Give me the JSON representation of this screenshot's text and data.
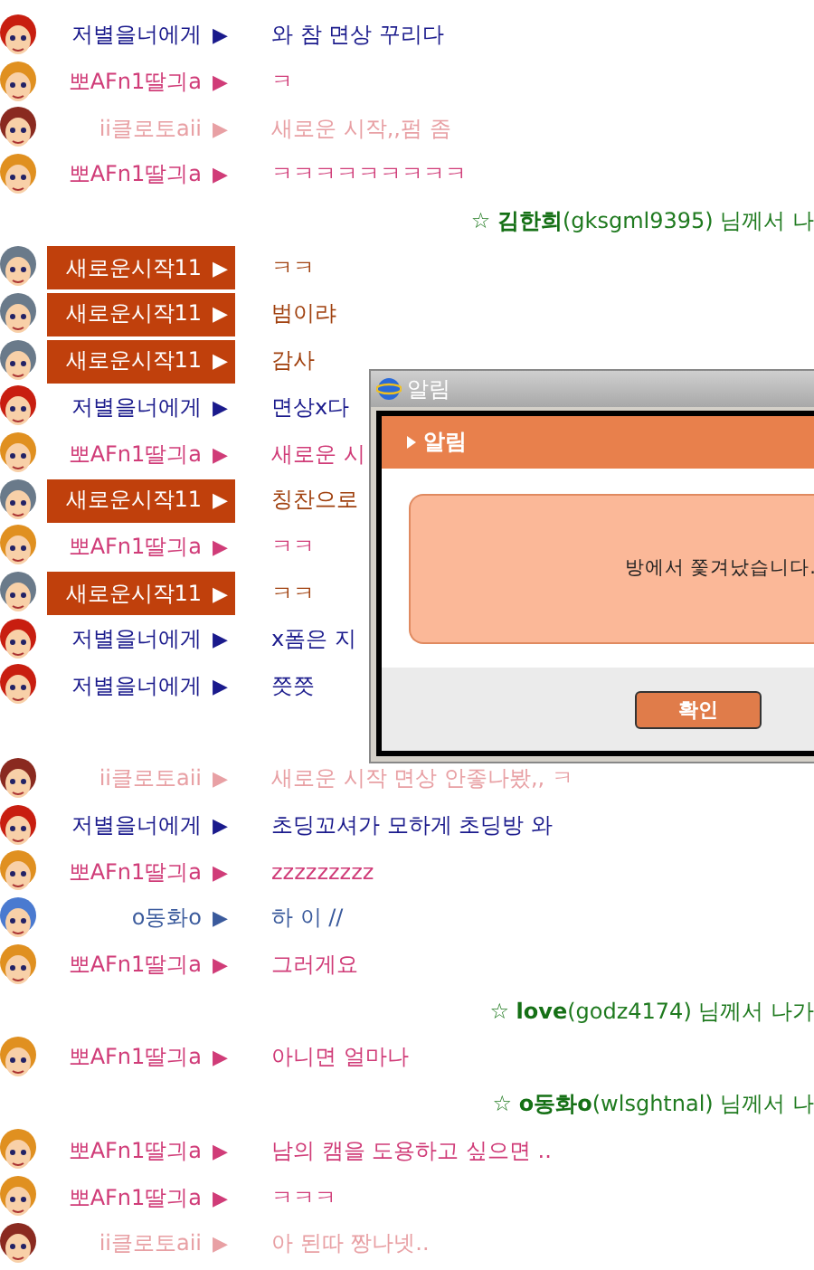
{
  "chat": [
    {
      "kind": "chat",
      "avatar": {
        "kind": "red-hair"
      },
      "name": "저별을너에게",
      "arrow": "▶",
      "text": "와 참 면상 꾸리다",
      "color": "#1a1a8c",
      "highlighted": false
    },
    {
      "kind": "chat",
      "avatar": {
        "kind": "blonde-hair"
      },
      "name": "뽀AFn1딸긔a",
      "arrow": "▶",
      "text": "ㅋ",
      "color": "#d03c78",
      "highlighted": false
    },
    {
      "kind": "chat",
      "avatar": {
        "kind": "brunette-hair"
      },
      "name": "ii클로토aii",
      "arrow": "▶",
      "text": "새로운 시작,,펌 좀",
      "color": "#e8a0a4",
      "highlighted": false
    },
    {
      "kind": "chat",
      "avatar": {
        "kind": "blonde-hair"
      },
      "name": "뽀AFn1딸긔a",
      "arrow": "▶",
      "text": "ㅋㅋㅋㅋㅋㅋㅋㅋㅋ",
      "color": "#d03c78",
      "highlighted": false
    },
    {
      "kind": "notice",
      "text": "☆ **김한희**(gksgml9395) 님께서 나"
    },
    {
      "kind": "chat",
      "avatar": {
        "kind": "grey-hair"
      },
      "name": "새로운시작11",
      "arrow": "▶",
      "text": "ㅋㅋ",
      "color": "#c0400c",
      "highlighted": true
    },
    {
      "kind": "chat",
      "avatar": {
        "kind": "grey-hair"
      },
      "name": "새로운시작11",
      "arrow": "▶",
      "text": "범이랴",
      "color": "#c0400c",
      "highlighted": true
    },
    {
      "kind": "chat",
      "avatar": {
        "kind": "grey-hair"
      },
      "name": "새로운시작11",
      "arrow": "▶",
      "text": "감사",
      "color": "#c0400c",
      "highlighted": true
    },
    {
      "kind": "chat",
      "avatar": {
        "kind": "red-hair"
      },
      "name": "저별을너에게",
      "arrow": "▶",
      "text": "면상x다",
      "color": "#1a1a8c",
      "highlighted": false
    },
    {
      "kind": "chat",
      "avatar": {
        "kind": "blonde-hair"
      },
      "name": "뽀AFn1딸긔a",
      "arrow": "▶",
      "text": "새로운 시",
      "color": "#d03c78",
      "highlighted": false
    },
    {
      "kind": "chat",
      "avatar": {
        "kind": "grey-hair"
      },
      "name": "새로운시작11",
      "arrow": "▶",
      "text": "칭찬으로",
      "color": "#c0400c",
      "highlighted": true
    },
    {
      "kind": "chat",
      "avatar": {
        "kind": "blonde-hair"
      },
      "name": "뽀AFn1딸긔a",
      "arrow": "▶",
      "text": "ㅋㅋ",
      "color": "#d03c78",
      "highlighted": false
    },
    {
      "kind": "chat",
      "avatar": {
        "kind": "grey-hair"
      },
      "name": "새로운시작11",
      "arrow": "▶",
      "text": "ㅋㅋ",
      "color": "#c0400c",
      "highlighted": true
    },
    {
      "kind": "chat",
      "avatar": {
        "kind": "red-hair"
      },
      "name": "저별을너에게",
      "arrow": "▶",
      "text": "x폼은 지",
      "color": "#1a1a8c",
      "highlighted": false
    },
    {
      "kind": "chat",
      "avatar": {
        "kind": "red-hair"
      },
      "name": "저별을너에게",
      "arrow": "▶",
      "text": "쯧쯧",
      "color": "#1a1a8c",
      "highlighted": false
    },
    {
      "kind": "gap"
    },
    {
      "kind": "chat",
      "avatar": {
        "kind": "brunette-hair"
      },
      "name": "ii클로토aii",
      "arrow": "▶",
      "text": "새로운 시작 면상 안좋나봤,, ㅋ",
      "color": "#e8a0a4",
      "highlighted": false
    },
    {
      "kind": "chat",
      "avatar": {
        "kind": "red-hair"
      },
      "name": "저별을너에게",
      "arrow": "▶",
      "text": "초딩꼬셔가 모하게 초딩방 와",
      "color": "#1a1a8c",
      "highlighted": false
    },
    {
      "kind": "chat",
      "avatar": {
        "kind": "blonde-hair"
      },
      "name": "뽀AFn1딸긔a",
      "arrow": "▶",
      "text": "zzzzzzzzz",
      "color": "#d03c78",
      "highlighted": false
    },
    {
      "kind": "chat",
      "avatar": {
        "kind": "hood"
      },
      "name": "o동화o",
      "arrow": "▶",
      "text": "하 이 //",
      "color": "#3a5a9c",
      "highlighted": false
    },
    {
      "kind": "chat",
      "avatar": {
        "kind": "blonde-hair"
      },
      "name": "뽀AFn1딸긔a",
      "arrow": "▶",
      "text": "그러게요",
      "color": "#d03c78",
      "highlighted": false
    },
    {
      "kind": "notice",
      "text": "☆ **love**(godz4174) 님께서 나가"
    },
    {
      "kind": "chat",
      "avatar": {
        "kind": "blonde-hair"
      },
      "name": "뽀AFn1딸긔a",
      "arrow": "▶",
      "text": "아니면 얼마나",
      "color": "#d03c78",
      "highlighted": false
    },
    {
      "kind": "notice",
      "text": "☆ **o동화o**(wlsghtnal) 님께서 나"
    },
    {
      "kind": "chat",
      "avatar": {
        "kind": "blonde-hair"
      },
      "name": "뽀AFn1딸긔a",
      "arrow": "▶",
      "text": "남의 캠을 도용하고 싶으면 ..",
      "color": "#d03c78",
      "highlighted": false
    },
    {
      "kind": "chat",
      "avatar": {
        "kind": "blonde-hair"
      },
      "name": "뽀AFn1딸긔a",
      "arrow": "▶",
      "text": "ㅋㅋㅋ",
      "color": "#d03c78",
      "highlighted": false
    },
    {
      "kind": "chat",
      "avatar": {
        "kind": "brunette-hair"
      },
      "name": "ii클로토aii",
      "arrow": "▶",
      "text": "아 된따 짱나넷..",
      "color": "#e8a0a4",
      "highlighted": false
    }
  ],
  "dialog": {
    "window_title": "알림",
    "header": "알림",
    "message": "방에서 쫓겨났습니다.",
    "button": "확인"
  }
}
